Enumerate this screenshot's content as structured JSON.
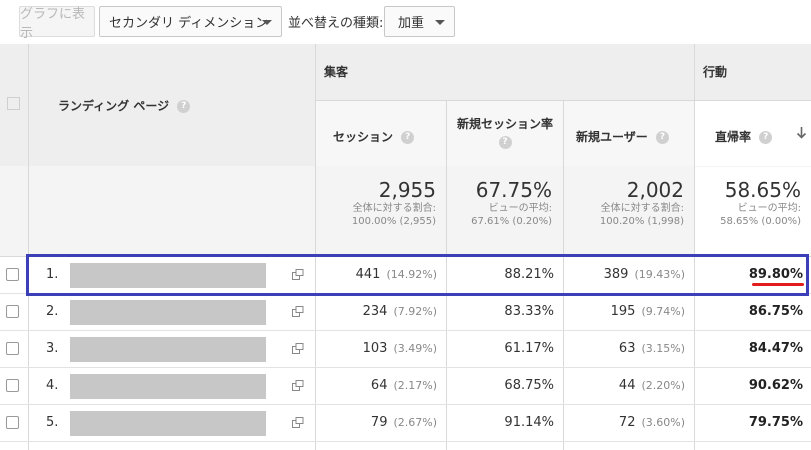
{
  "toolbar": {
    "graph_button": "グラフに表示",
    "secondary_dimension": "セカンダリ ディメンション",
    "sort_label": "並べ替えの種類:",
    "sort_value": "加重"
  },
  "table": {
    "col_landing": "ランディング ページ",
    "group_acquisition": "集客",
    "group_behavior": "行動",
    "col_sessions": "セッション",
    "col_new_session_rate": "新規セッション率",
    "col_new_users": "新規ユーザー",
    "col_bounce_rate": "直帰率"
  },
  "totals": {
    "sessions": {
      "value": "2,955",
      "line1": "全体に対する割合:",
      "line2": "100.00% (2,955)"
    },
    "new_session_rate": {
      "value": "67.75%",
      "line1": "ビューの平均:",
      "line2": "67.61% (0.20%)"
    },
    "new_users": {
      "value": "2,002",
      "line1": "全体に対する割合:",
      "line2": "100.20% (1,998)"
    },
    "bounce_rate": {
      "value": "58.65%",
      "line1": "ビューの平均:",
      "line2": "58.65% (0.00%)"
    }
  },
  "rows": [
    {
      "num": "1.",
      "sessions": "441",
      "sessions_pct": "(14.92%)",
      "new_rate": "88.21%",
      "new_users": "389",
      "new_users_pct": "(19.43%)",
      "bounce": "89.80%"
    },
    {
      "num": "2.",
      "sessions": "234",
      "sessions_pct": "(7.92%)",
      "new_rate": "83.33%",
      "new_users": "195",
      "new_users_pct": "(9.74%)",
      "bounce": "86.75%"
    },
    {
      "num": "3.",
      "sessions": "103",
      "sessions_pct": "(3.49%)",
      "new_rate": "61.17%",
      "new_users": "63",
      "new_users_pct": "(3.15%)",
      "bounce": "84.47%"
    },
    {
      "num": "4.",
      "sessions": "64",
      "sessions_pct": "(2.17%)",
      "new_rate": "68.75%",
      "new_users": "44",
      "new_users_pct": "(2.20%)",
      "bounce": "90.62%"
    },
    {
      "num": "5.",
      "sessions": "79",
      "sessions_pct": "(2.67%)",
      "new_rate": "91.14%",
      "new_users": "72",
      "new_users_pct": "(3.60%)",
      "bounce": "79.75%"
    }
  ],
  "colors": {
    "highlight_border": "#3b3fb8",
    "annotation_underline": "#e31c1c"
  }
}
